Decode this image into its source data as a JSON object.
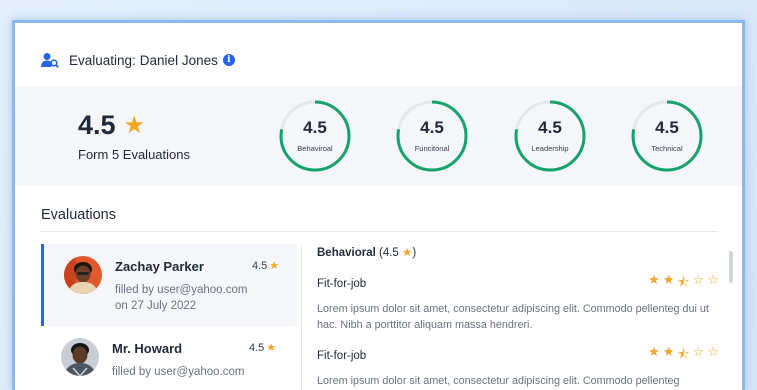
{
  "header": {
    "prefix": "Evaluating:",
    "name": "Daniel Jones"
  },
  "summary": {
    "score": "4.5",
    "evaluations_label": "Form 5 Evaluations",
    "gauges": [
      {
        "value": "4.5",
        "label": "Behaviroal",
        "fill": 0.78
      },
      {
        "value": "4.5",
        "label": "Funcitonal",
        "fill": 0.78
      },
      {
        "value": "4.5",
        "label": "Leadership",
        "fill": 0.78
      },
      {
        "value": "4.5",
        "label": "Technical",
        "fill": 0.78
      }
    ],
    "gauge_color": "#16a36a"
  },
  "evaluations": {
    "title": "Evaluations",
    "items": [
      {
        "name": "Zachay Parker",
        "score": "4.5",
        "filled_by": "filled by user@yahoo.com",
        "date": "on 27 July 2022"
      },
      {
        "name": "Mr. Howard",
        "score": "4.5",
        "filled_by": "filled by user@yahoo.com",
        "date": ""
      }
    ]
  },
  "detail": {
    "category": "Behavioral",
    "category_score": "(4.5",
    "criteria": [
      {
        "title": "Fit-for-job",
        "rating": 2.5,
        "text": "Lorem ipsum dolor sit amet, consectetur adipiscing elit. Commodo pellenteg dui ut hac. Nibh a porttitor aliquam massa hendreri."
      },
      {
        "title": "Fit-for-job",
        "rating": 2.5,
        "text": "Lorem ipsum dolor sit amet, consectetur adipiscing elit. Commodo pellenteg"
      }
    ]
  },
  "colors": {
    "accent": "#2563eb",
    "star": "#f5a623"
  }
}
